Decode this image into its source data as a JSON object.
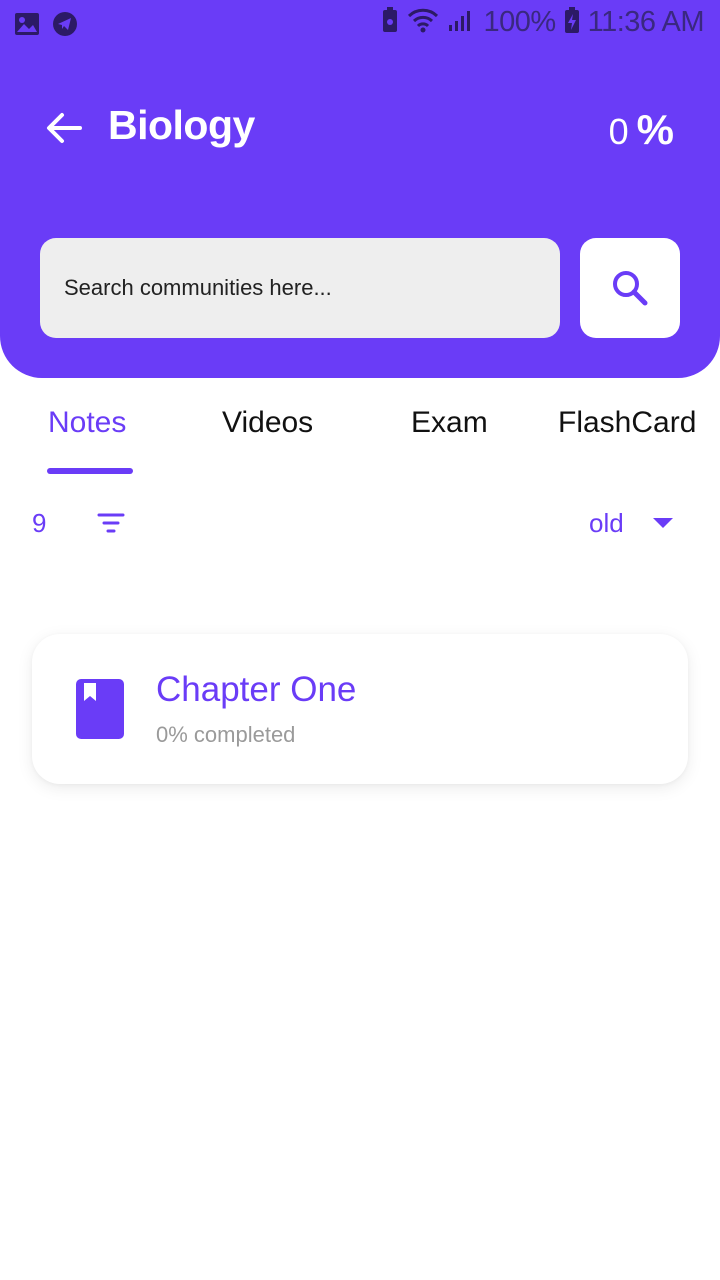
{
  "status_bar": {
    "battery": "100%",
    "time": "11:36 AM"
  },
  "header": {
    "title": "Biology",
    "progress_value": "0",
    "progress_symbol": "%",
    "background_color": "#6a3cf7"
  },
  "search": {
    "placeholder": "Search communities here..."
  },
  "tabs": [
    {
      "label": "Notes",
      "active": true
    },
    {
      "label": "Videos",
      "active": false
    },
    {
      "label": "Exam",
      "active": false
    },
    {
      "label": "FlashCard",
      "active": false
    }
  ],
  "filter_bar": {
    "count": "9",
    "sort_value": "old"
  },
  "items": [
    {
      "title": "Chapter One",
      "subtitle": "0% completed",
      "icon": "bookmark-book-icon"
    }
  ],
  "colors": {
    "accent": "#6a3cf7",
    "muted_text": "#9a9a9a",
    "search_bg": "#eeeeee"
  }
}
